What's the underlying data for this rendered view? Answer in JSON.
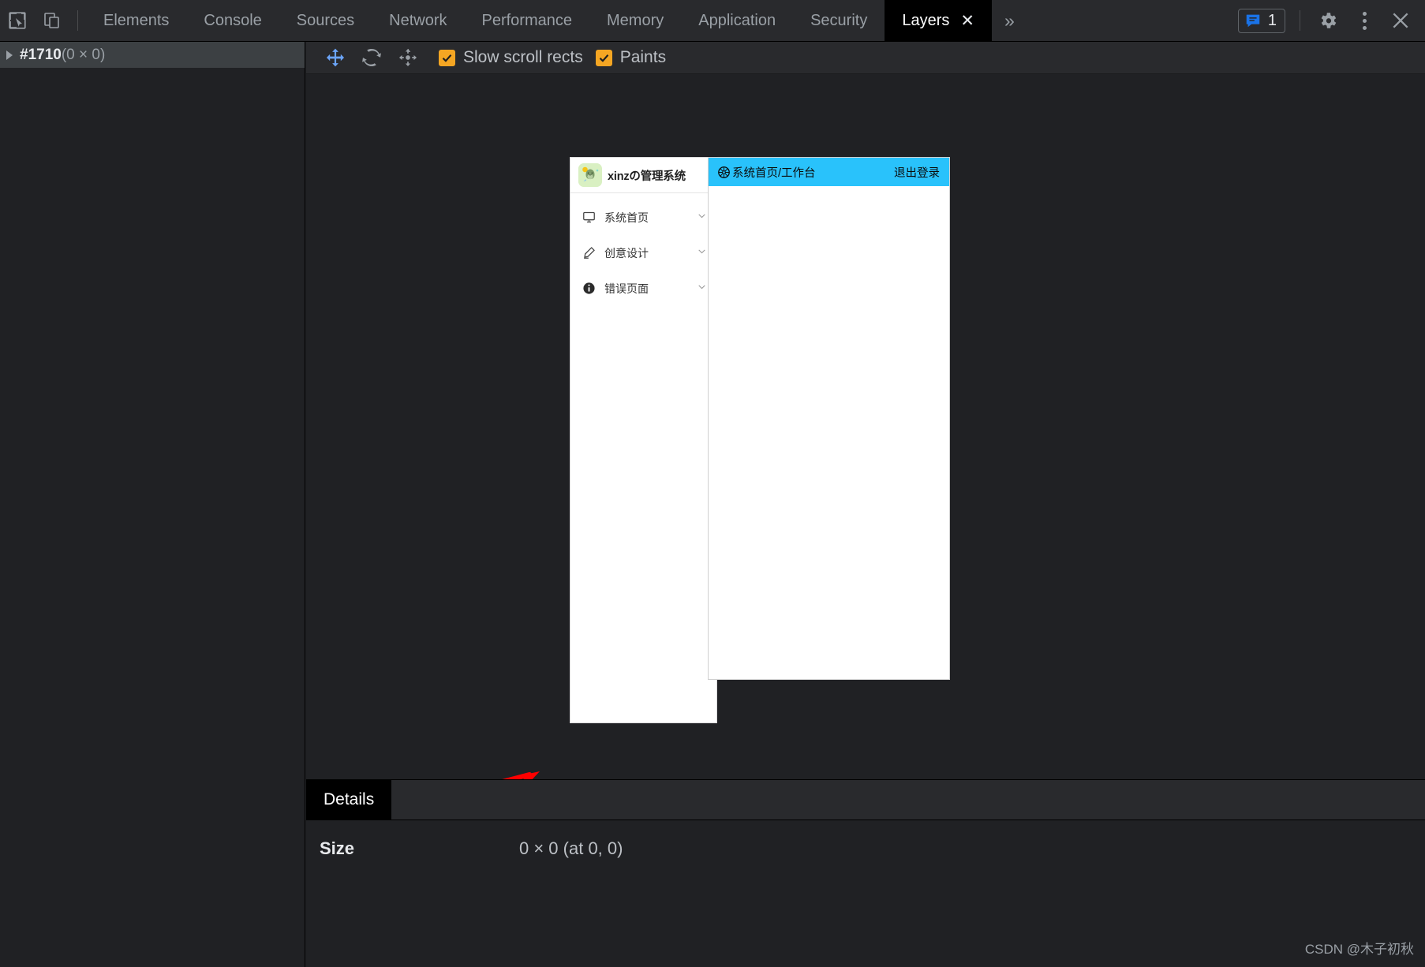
{
  "devtools": {
    "tabs": [
      {
        "label": "Elements",
        "active": false
      },
      {
        "label": "Console",
        "active": false
      },
      {
        "label": "Sources",
        "active": false
      },
      {
        "label": "Network",
        "active": false
      },
      {
        "label": "Performance",
        "active": false
      },
      {
        "label": "Memory",
        "active": false
      },
      {
        "label": "Application",
        "active": false
      },
      {
        "label": "Security",
        "active": false
      },
      {
        "label": "Layers",
        "active": true
      }
    ],
    "active_tab_close": "✕",
    "more_tabs": "»",
    "issues_count": "1",
    "icons": {
      "inspect": "inspect-element-icon",
      "device": "device-toolbar-icon",
      "issues": "issues-message-icon",
      "settings": "gear-icon",
      "kebab": "more-options-icon",
      "close": "close-icon"
    }
  },
  "tree": {
    "item_id": "#1710",
    "item_dims": "(0 × 0)"
  },
  "layers_toolbar": {
    "pan_icon": "pan-tool-icon",
    "rotate_icon": "rotate-tool-icon",
    "reset_icon": "reset-transform-icon",
    "checkboxes": [
      {
        "label": "Slow scroll rects",
        "checked": true
      },
      {
        "label": "Paints",
        "checked": true
      }
    ]
  },
  "page_preview": {
    "sidebar": {
      "logo_name": "dinosaur-avatar-logo",
      "title": "xinzの管理系统",
      "menu": [
        {
          "label": "系统首页",
          "icon": "monitor-icon"
        },
        {
          "label": "创意设计",
          "icon": "pencil-icon"
        },
        {
          "label": "错误页面",
          "icon": "info-circle-icon"
        }
      ],
      "chevron": "chevron-down-icon"
    },
    "main": {
      "header_icon": "wheel-icon",
      "header_title": "系统首页/工作台",
      "logout_label": "退出登录",
      "header_color": "#29c2fb"
    }
  },
  "annotation": {
    "arrow_color": "#ff0000"
  },
  "details_panel": {
    "tab_label": "Details",
    "rows": [
      {
        "key": "Size",
        "value": "0 × 0 (at 0, 0)"
      }
    ]
  },
  "watermark": {
    "text": "CSDN @木子初秋"
  }
}
